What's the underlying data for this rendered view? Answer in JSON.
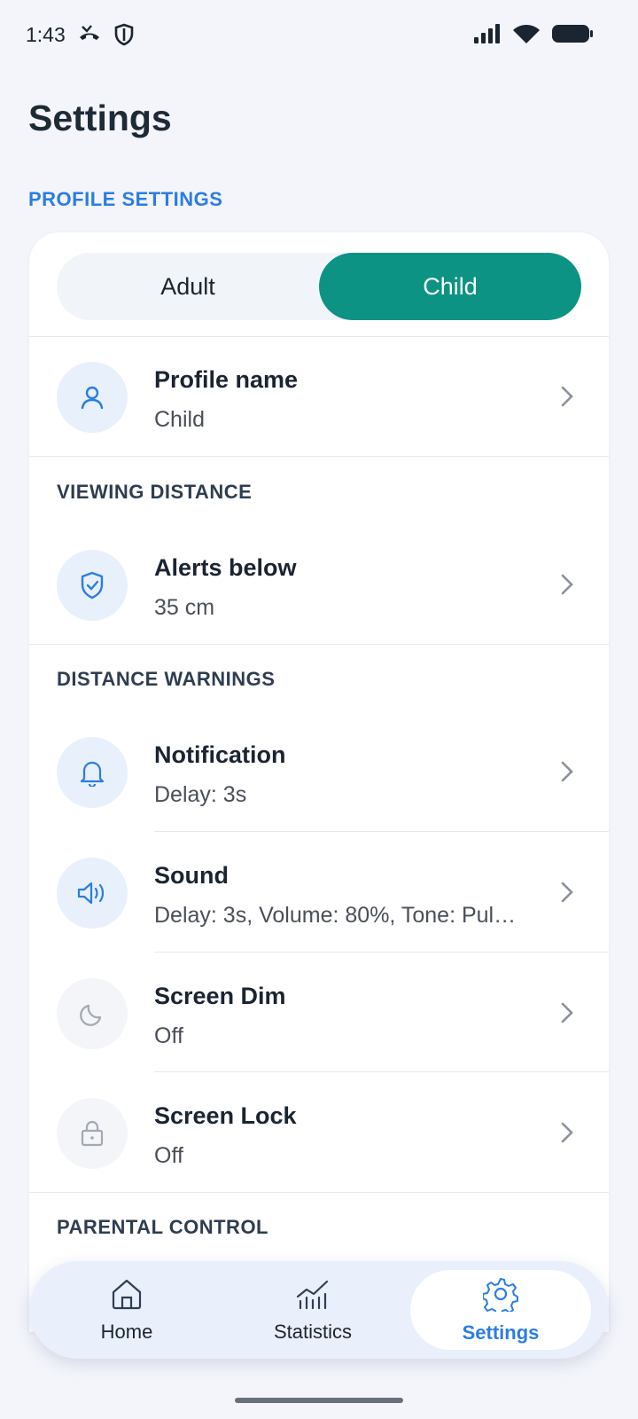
{
  "status_bar": {
    "time": "1:43",
    "icons": [
      "missed-call-icon",
      "shield-icon",
      "signal-icon",
      "wifi-icon",
      "battery-icon"
    ]
  },
  "page": {
    "title": "Settings",
    "section_header": "PROFILE SETTINGS"
  },
  "profile_toggle": {
    "options": [
      "Adult",
      "Child"
    ],
    "selected": "Child"
  },
  "rows": {
    "profile_name": {
      "title": "Profile name",
      "value": "Child",
      "icon": "user-icon"
    },
    "viewing_distance_label": "VIEWING DISTANCE",
    "alerts_below": {
      "title": "Alerts below",
      "value": "35 cm",
      "icon": "shield-check-icon"
    },
    "distance_warnings_label": "DISTANCE WARNINGS",
    "notification": {
      "title": "Notification",
      "value": "Delay: 3s",
      "icon": "bell-icon"
    },
    "sound": {
      "title": "Sound",
      "value": "Delay: 3s, Volume: 80%, Tone: Pul…",
      "icon": "speaker-icon"
    },
    "screen_dim": {
      "title": "Screen Dim",
      "value": "Off",
      "icon": "moon-icon"
    },
    "screen_lock": {
      "title": "Screen Lock",
      "value": "Off",
      "icon": "lock-icon"
    },
    "parental_control_label": "PARENTAL CONTROL"
  },
  "bottom_nav": {
    "items": [
      {
        "label": "Home",
        "icon": "home-icon"
      },
      {
        "label": "Statistics",
        "icon": "chart-icon"
      },
      {
        "label": "Settings",
        "icon": "gear-icon"
      }
    ],
    "active": "Settings"
  },
  "colors": {
    "accent_blue": "#2b7de1",
    "toggle_teal": "#0d9384",
    "background": "#f3f5fb"
  }
}
